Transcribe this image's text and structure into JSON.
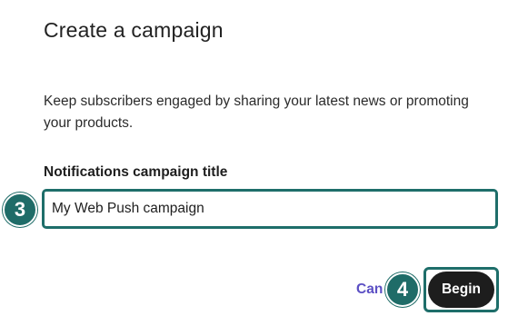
{
  "dialog": {
    "title": "Create a campaign",
    "description": "Keep subscribers engaged by sharing your latest news or promoting your products."
  },
  "form": {
    "title_label": "Notifications campaign title",
    "title_value": "My Web Push campaign"
  },
  "steps": {
    "step_input": "3",
    "step_begin": "4"
  },
  "actions": {
    "cancel_label": "Can",
    "begin_label": "Begin"
  },
  "colors": {
    "accent_teal": "#1e6e6a",
    "cancel_link": "#5b4fc4",
    "primary_button": "#1d1d1d"
  }
}
